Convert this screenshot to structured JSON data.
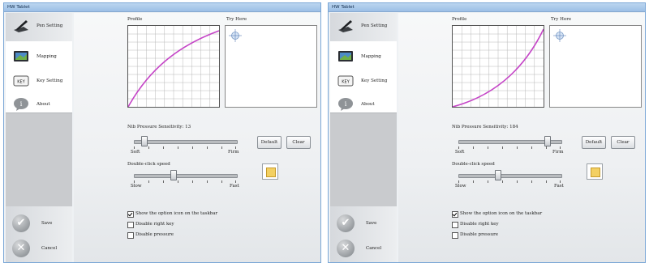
{
  "windows": [
    {
      "title": "HW Tablet",
      "nav": [
        {
          "label": "Pen Setting",
          "active": false
        },
        {
          "label": "Mapping",
          "active": false
        },
        {
          "label": "Key Setting",
          "active": false
        },
        {
          "label": "About",
          "active": false
        }
      ],
      "actions": [
        {
          "label": "Save"
        },
        {
          "label": "Cancel"
        }
      ],
      "profile_label": "Profile",
      "try_label": "Try Here",
      "sensitivity_label": "Nib Pressure Sensitivity: 13",
      "soft_label": "Soft",
      "firm_label": "Firm",
      "default_button": "Default",
      "clear_button": "Clear",
      "double_click_label": "Double-click speed",
      "slow_label": "Slow",
      "fast_label": "Fast",
      "checkboxes": [
        {
          "label": "Show the option icon on the taskbar",
          "checked": true
        },
        {
          "label": "Disable right key",
          "checked": false
        },
        {
          "label": "Disable pressure",
          "checked": false
        }
      ],
      "sensitivity_level": 0.08,
      "doubleclick_level": 0.38,
      "curve": "concave"
    },
    {
      "title": "HW Tablet",
      "nav": [
        {
          "label": "Pen Setting",
          "active": false
        },
        {
          "label": "Mapping",
          "active": false
        },
        {
          "label": "Key Setting",
          "active": false
        },
        {
          "label": "About",
          "active": false
        }
      ],
      "actions": [
        {
          "label": "Save"
        },
        {
          "label": "Cancel"
        }
      ],
      "profile_label": "Profile",
      "try_label": "Try Here",
      "sensitivity_label": "Nib Pressure Sensitivity: 184",
      "soft_label": "Soft",
      "firm_label": "Firm",
      "default_button": "Default",
      "clear_button": "Clear",
      "double_click_label": "Double-click speed",
      "slow_label": "Slow",
      "fast_label": "Fast",
      "checkboxes": [
        {
          "label": "Show the option icon on the taskbar",
          "checked": true
        },
        {
          "label": "Disable right key",
          "checked": false
        },
        {
          "label": "Disable pressure",
          "checked": false
        }
      ],
      "sensitivity_level": 0.9,
      "doubleclick_level": 0.38,
      "curve": "convex"
    }
  ],
  "colors": {
    "curve": "#c545c7",
    "grid": "#b8b8b8",
    "titlebar": "#a9c9ec",
    "sidebar_gray": "#c9cbce"
  }
}
